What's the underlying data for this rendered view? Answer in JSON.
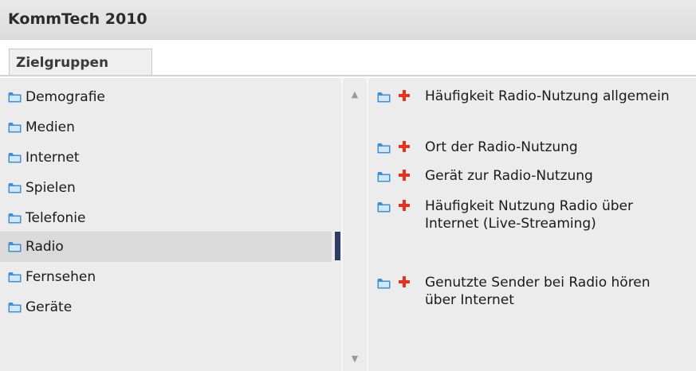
{
  "app": {
    "title": "KommTech 2010"
  },
  "tabs": [
    {
      "label": "Zielgruppen"
    }
  ],
  "categories": [
    {
      "label": "Demografie"
    },
    {
      "label": "Medien"
    },
    {
      "label": "Internet"
    },
    {
      "label": "Spielen"
    },
    {
      "label": "Telefonie"
    },
    {
      "label": "Radio",
      "selected": true
    },
    {
      "label": "Fernsehen"
    },
    {
      "label": "Geräte"
    }
  ],
  "subitems": [
    {
      "label": "Häufigkeit Radio-Nutzung allgemein"
    },
    {
      "label": "Ort der Radio-Nutzung"
    },
    {
      "label": "Gerät zur Radio-Nutzung"
    },
    {
      "label": "Häufigkeit Nutzung Radio über Internet (Live-Streaming)"
    },
    {
      "label": "Genutzte Sender bei Radio hören über Internet"
    }
  ],
  "icons": {
    "folder": "folder-icon",
    "expand": "plus-icon",
    "scroll_up": "scroll-up-arrow",
    "scroll_down": "scroll-down-arrow"
  },
  "colors": {
    "folder": "#3f8fd6",
    "plus": "#e8321e",
    "selection_marker": "#2e3d66",
    "selected_row": "#dadada"
  }
}
